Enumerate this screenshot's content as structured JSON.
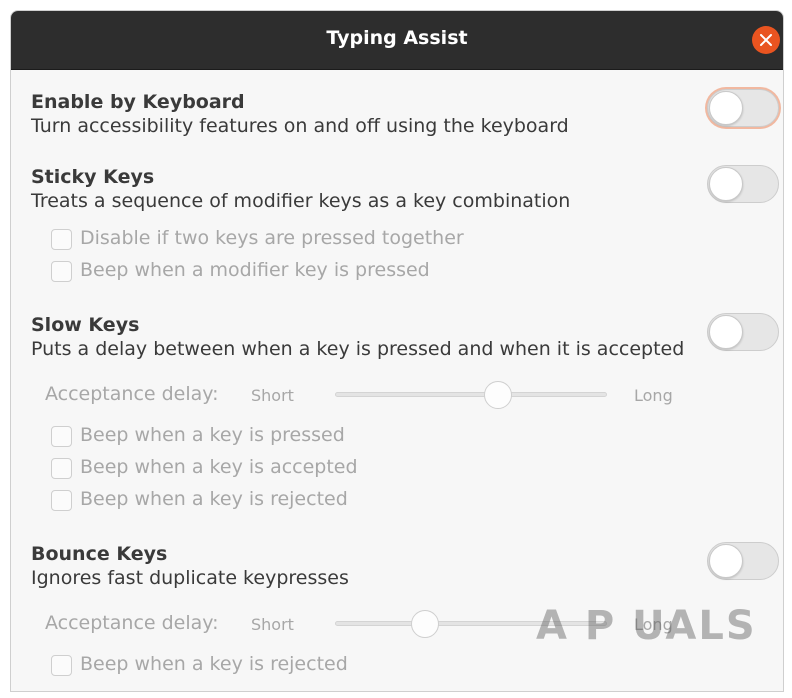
{
  "window": {
    "title": "Typing Assist"
  },
  "sections": {
    "enable_by_keyboard": {
      "heading": "Enable by Keyboard",
      "description": "Turn accessibility features on and off using the keyboard",
      "enabled": false
    },
    "sticky_keys": {
      "heading": "Sticky Keys",
      "description": "Treats a sequence of modifier keys as a key combination",
      "enabled": false,
      "options": [
        {
          "label": "Disable if two keys are pressed together",
          "checked": false
        },
        {
          "label": "Beep when a modifier key is pressed",
          "checked": false
        }
      ]
    },
    "slow_keys": {
      "heading": "Slow Keys",
      "description": "Puts a delay between when a key is pressed and when it is accepted",
      "enabled": false,
      "delay": {
        "label": "Acceptance delay:",
        "min_label": "Short",
        "max_label": "Long",
        "value": 0.6
      },
      "options": [
        {
          "label": "Beep when a key is pressed",
          "checked": false
        },
        {
          "label": "Beep when a key is accepted",
          "checked": false
        },
        {
          "label": "Beep when a key is rejected",
          "checked": false
        }
      ]
    },
    "bounce_keys": {
      "heading": "Bounce Keys",
      "description": "Ignores fast duplicate keypresses",
      "enabled": false,
      "delay": {
        "label": "Acceptance delay:",
        "min_label": "Short",
        "max_label": "Long",
        "value": 0.33
      },
      "options": [
        {
          "label": "Beep when a key is rejected",
          "checked": false
        }
      ]
    }
  },
  "watermark": {
    "text": "APPUALS"
  },
  "colors": {
    "titlebar": "#2d2d2d",
    "close_button": "#e95420",
    "focus_ring": "#f1b8a0"
  }
}
